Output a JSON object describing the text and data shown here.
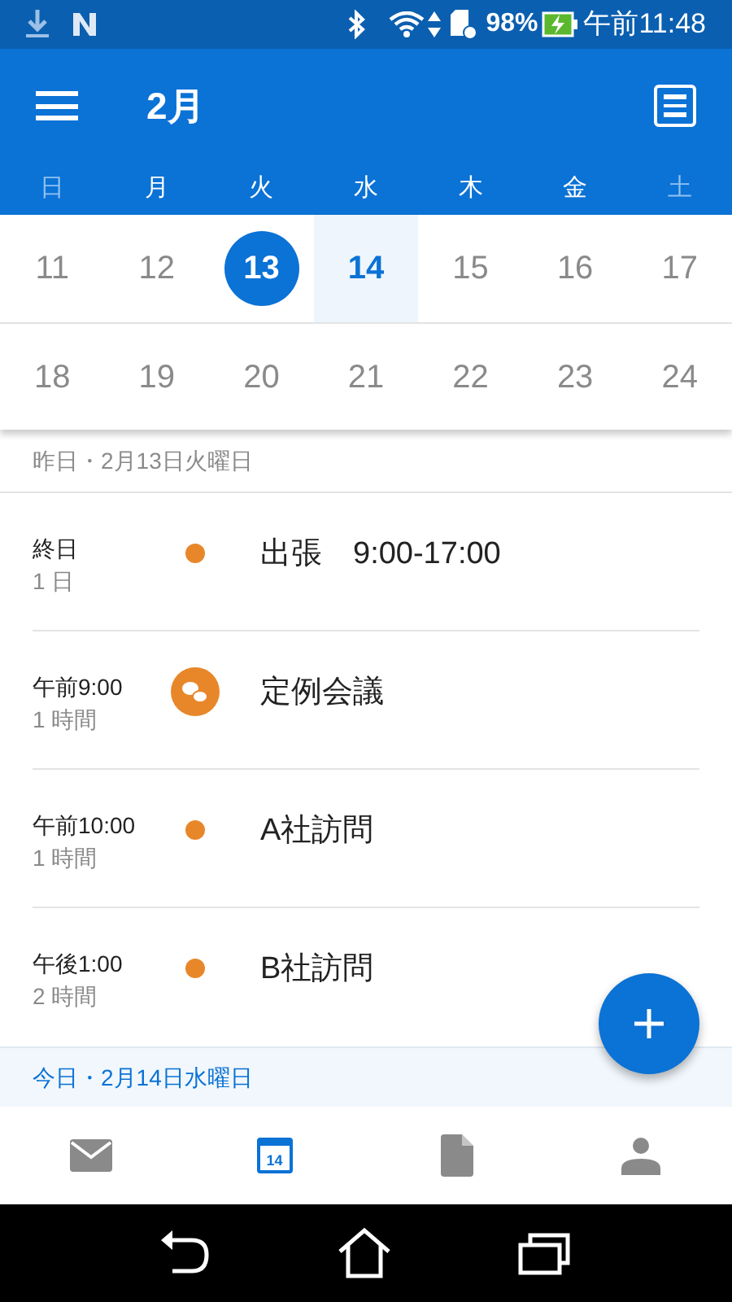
{
  "status_bar": {
    "battery": "98%",
    "time": "午前11:48"
  },
  "header": {
    "title": "2月"
  },
  "weekdays": [
    {
      "label": "日",
      "weekend": true
    },
    {
      "label": "月",
      "weekend": false
    },
    {
      "label": "火",
      "weekend": false
    },
    {
      "label": "水",
      "weekend": false
    },
    {
      "label": "木",
      "weekend": false
    },
    {
      "label": "金",
      "weekend": false
    },
    {
      "label": "土",
      "weekend": true
    }
  ],
  "weeks": [
    [
      {
        "day": "11",
        "selected": false,
        "today": false
      },
      {
        "day": "12",
        "selected": false,
        "today": false
      },
      {
        "day": "13",
        "selected": true,
        "today": false
      },
      {
        "day": "14",
        "selected": false,
        "today": true
      },
      {
        "day": "15",
        "selected": false,
        "today": false
      },
      {
        "day": "16",
        "selected": false,
        "today": false
      },
      {
        "day": "17",
        "selected": false,
        "today": false
      }
    ],
    [
      {
        "day": "18",
        "selected": false,
        "today": false
      },
      {
        "day": "19",
        "selected": false,
        "today": false
      },
      {
        "day": "20",
        "selected": false,
        "today": false
      },
      {
        "day": "21",
        "selected": false,
        "today": false
      },
      {
        "day": "22",
        "selected": false,
        "today": false
      },
      {
        "day": "23",
        "selected": false,
        "today": false
      },
      {
        "day": "24",
        "selected": false,
        "today": false
      }
    ]
  ],
  "sections": [
    {
      "heading": "昨日・2月13日火曜日",
      "today": false,
      "events": [
        {
          "time": "終日",
          "duration": "1 日",
          "kind": "dot",
          "title": "出張　9:00-17:00",
          "color": "#e8872a"
        },
        {
          "time": "午前9:00",
          "duration": "1 時間",
          "kind": "meeting",
          "title": "定例会議",
          "color": "#e8872a"
        },
        {
          "time": "午前10:00",
          "duration": "1 時間",
          "kind": "dot",
          "title": "A社訪問",
          "color": "#e8872a"
        },
        {
          "time": "午後1:00",
          "duration": "2 時間",
          "kind": "dot",
          "title": "B社訪問",
          "color": "#e8872a"
        }
      ]
    },
    {
      "heading": "今日・2月14日水曜日",
      "today": true
    }
  ],
  "bottom_nav": [
    {
      "kind": "mail",
      "selected": false
    },
    {
      "kind": "calendar",
      "label": "14",
      "selected": true
    },
    {
      "kind": "files",
      "selected": false
    },
    {
      "kind": "people",
      "selected": false
    }
  ]
}
